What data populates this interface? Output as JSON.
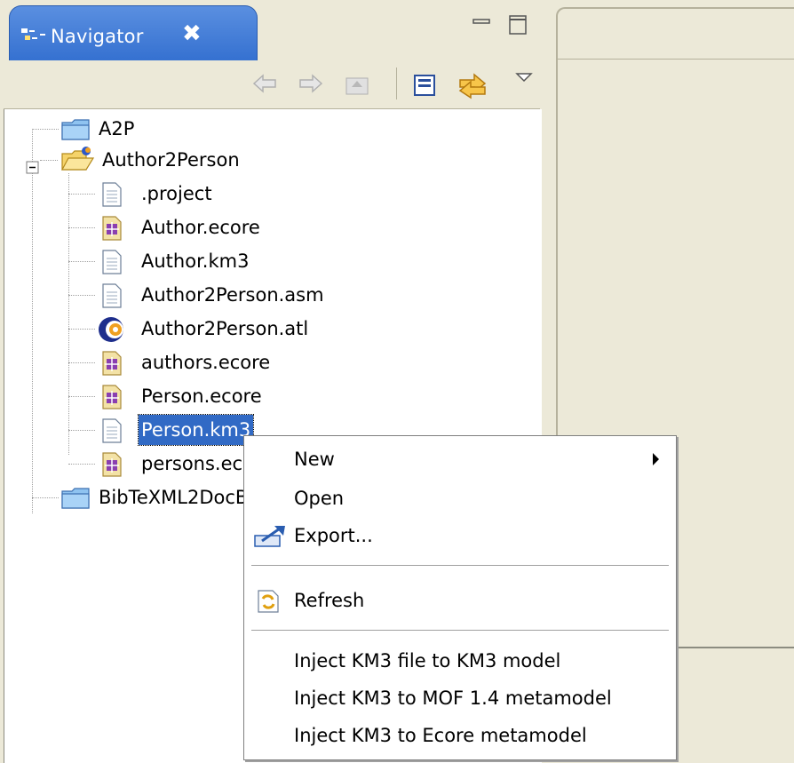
{
  "navigator": {
    "tab_title": "Navigator",
    "close_glyph": "✖"
  },
  "toolbar": {
    "buttons": [
      "back-icon",
      "forward-icon",
      "up-folder-icon",
      "collapse-all-icon",
      "link-with-editor-icon",
      "view-menu-icon"
    ]
  },
  "tree": {
    "projects": [
      {
        "label": "A2P"
      },
      {
        "label": "Author2Person",
        "expanded": true
      },
      {
        "label": "BibTeXML2DocBook"
      }
    ],
    "children": [
      {
        "label": ".project",
        "icon": "text-file-icon"
      },
      {
        "label": "Author.ecore",
        "icon": "ecore-file-icon"
      },
      {
        "label": "Author.km3",
        "icon": "text-file-icon"
      },
      {
        "label": "Author2Person.asm",
        "icon": "text-file-icon"
      },
      {
        "label": "Author2Person.atl",
        "icon": "atl-file-icon"
      },
      {
        "label": "authors.ecore",
        "icon": "ecore-file-icon"
      },
      {
        "label": "Person.ecore",
        "icon": "ecore-file-icon"
      },
      {
        "label": "Person.km3",
        "icon": "text-file-icon",
        "selected": true
      },
      {
        "label": "persons.ecore",
        "icon": "ecore-file-icon"
      }
    ]
  },
  "context_menu": {
    "items": [
      {
        "label": "New",
        "has_submenu": true
      },
      {
        "label": "Open"
      },
      {
        "label": "Export...",
        "icon": "export-icon"
      },
      {
        "label": "Refresh",
        "icon": "refresh-icon"
      },
      {
        "label": "Inject KM3 file to KM3 model"
      },
      {
        "label": "Inject KM3 to MOF 1.4 metamodel"
      },
      {
        "label": "Inject KM3 to Ecore metamodel"
      }
    ]
  },
  "colors": {
    "tab_blue": "#3470d0",
    "selection": "#316ac5",
    "window_bg": "#ece9d8"
  }
}
